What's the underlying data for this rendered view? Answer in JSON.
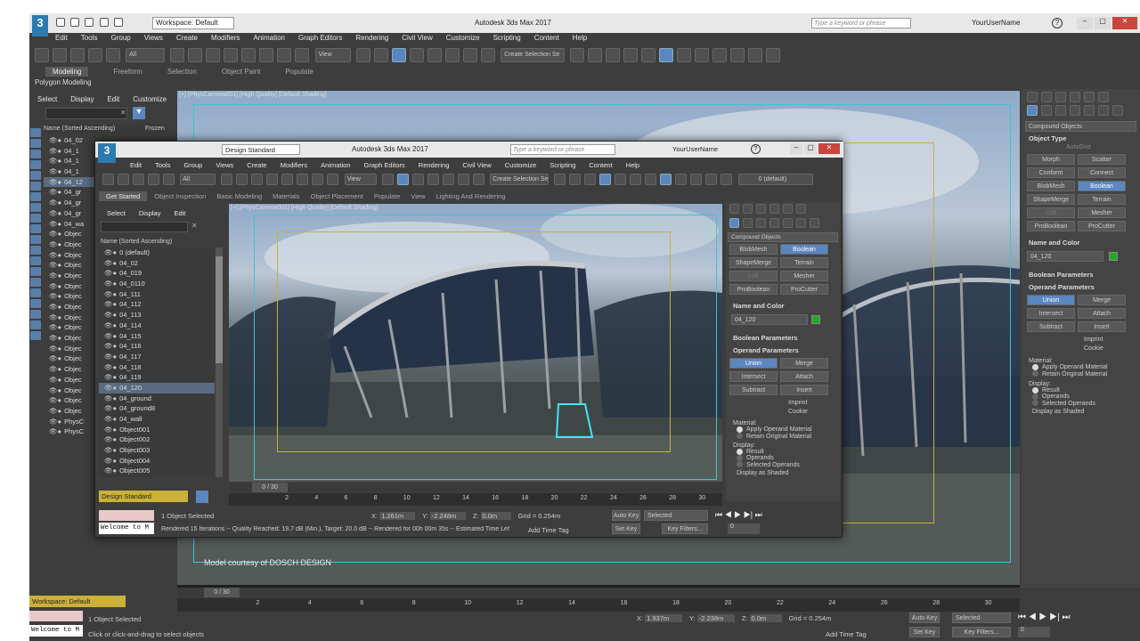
{
  "outer": {
    "title": "Autodesk 3ds Max 2017",
    "workspace": "Workspace: Default",
    "search_placeholder": "Type a keyword or phrase",
    "user": "YourUserName",
    "menu": [
      "Edit",
      "Tools",
      "Group",
      "Views",
      "Create",
      "Modifiers",
      "Animation",
      "Graph Editors",
      "Rendering",
      "Civil View",
      "Customize",
      "Scripting",
      "Content",
      "Help"
    ],
    "filter": "All",
    "view_dropdown": "View",
    "create_selection": "Create Selection Se",
    "ribbon_tabs": [
      "Modeling",
      "Freeform",
      "Selection",
      "Object Paint",
      "Populate"
    ],
    "ribbon_sub": "Polygon Modeling",
    "scene_menu": [
      "Select",
      "Display",
      "Edit",
      "Customize"
    ],
    "col_header": "Name (Sorted Ascending)",
    "frozen": "Frozen",
    "rows": [
      "04_02",
      "04_1",
      "04_1",
      "04_1",
      "04_12",
      "04_gr",
      "04_gr",
      "04_gr",
      "04_wa",
      "Objec",
      "Objec",
      "Objec",
      "Objec",
      "Objec",
      "Objec",
      "Objec",
      "Objec",
      "Objec",
      "Objec",
      "Objec",
      "Objec",
      "Objec",
      "Objec",
      "Objec",
      "Objec",
      "Objec",
      "Objec",
      "PhysC",
      "PhysC"
    ],
    "viewport_label": "[+] [PhysCamera001] [High Quality] [Default Shading]",
    "credit": "Model courtesy of DOSCH DESIGN",
    "frame_counter": "0 / 30",
    "ruler": [
      "2",
      "4",
      "6",
      "8",
      "10",
      "12",
      "14",
      "16",
      "18",
      "20",
      "22",
      "24",
      "26",
      "28",
      "30"
    ],
    "status_selected": "1 Object Selected",
    "status_prompt": "Click or click-and-drag to select objects",
    "maxscript": "Welcome to M",
    "coord_x": "1.937m",
    "coord_y": "-2.238m",
    "coord_z": "0.0m",
    "grid": "Grid = 0.254m",
    "add_time_tag": "Add Time Tag",
    "auto_key": "Auto Key",
    "selected": "Selected",
    "set_key": "Set Key",
    "key_filters": "Key Filters...",
    "frame_field": "0",
    "workspace_bottom": "Workspace: Default",
    "compound": "Compound Objects",
    "object_type": "Object Type",
    "autogrid": "AutoGrid",
    "types": [
      [
        "Morph",
        "Scatter"
      ],
      [
        "Conform",
        "Connect"
      ],
      [
        "BlobMesh",
        "Boolean"
      ],
      [
        "ShapeMerge",
        "Terrain"
      ],
      [
        "Loft",
        "Mesher"
      ],
      [
        "ProBoolean",
        "ProCutter"
      ]
    ],
    "name_color": "Name and Color",
    "obj_name": "04_120",
    "boolean_params": "Boolean Parameters",
    "operand_params": "Operand Parameters",
    "ops": [
      [
        "Union",
        "Merge"
      ],
      [
        "Intersect",
        "Attach"
      ],
      [
        "Subtract",
        "Insert"
      ]
    ],
    "imprint": "Imprint",
    "cookie": "Cookie",
    "material": "Material:",
    "mat_opts": [
      "Apply Operand Material",
      "Retain Original Material"
    ],
    "display": "Display:",
    "disp_opts": [
      "Result",
      "Operands",
      "Selected Operands"
    ],
    "display_shaded": "Display as Shaded"
  },
  "inner": {
    "title": "Autodesk 3ds Max 2017",
    "workspace": "Design Standard",
    "search_placeholder": "Type a keyword or phrase",
    "user": "YourUserName",
    "menu": [
      "Edit",
      "Tools",
      "Group",
      "Views",
      "Create",
      "Modifiers",
      "Animation",
      "Graph Editors",
      "Rendering",
      "Civil View",
      "Customize",
      "Scripting",
      "Content",
      "Help"
    ],
    "filter": "All",
    "view_dropdown": "View",
    "create_selection": "Create Selection Se",
    "layer_default": "0 (default)",
    "ribbon_tabs": [
      "Get Started",
      "Object Inspection",
      "Basic Modeling",
      "Materials",
      "Object Placement",
      "Populate",
      "View",
      "Lighting And Rendering"
    ],
    "scene_menu": [
      "Select",
      "Display",
      "Edit"
    ],
    "col_header": "Name (Sorted Ascending)",
    "rows": [
      "0 (default)",
      "04_02",
      "04_019",
      "04_0110",
      "04_111",
      "04_112",
      "04_113",
      "04_114",
      "04_115",
      "04_116",
      "04_117",
      "04_118",
      "04_119",
      "04_120",
      "04_ground",
      "04_ground8",
      "04_wall",
      "Object001",
      "Object002",
      "Object003",
      "Object004",
      "Object005"
    ],
    "viewport_label": "[+] [PhysCamera001] [High Quality] [Default Shading]",
    "workspace_bottom": "Design Standard",
    "frame_counter": "0 / 30",
    "ruler": [
      "2",
      "4",
      "6",
      "8",
      "10",
      "12",
      "14",
      "16",
      "18",
      "20",
      "22",
      "24",
      "26",
      "28",
      "30"
    ],
    "status_selected": "1 Object Selected",
    "status_render": "Rendered 15 Iterations -- Quality Reached: 19.7 dB (Min.), Target: 20.0 dB -- Rendered for 00h 00m 35s -- Estimated Time Lef",
    "maxscript": "Welcome to M",
    "coord_x": "1.261m",
    "coord_y": "-2.248m",
    "coord_z": "0.0m",
    "grid": "Grid = 0.254m",
    "add_time_tag": "Add Time Tag",
    "auto_key": "Auto Key",
    "selected": "Selected",
    "set_key": "Set Key",
    "key_filters": "Key Filters...",
    "frame_field": "0",
    "compound": "Compound Objects",
    "types": [
      [
        "BlobMesh",
        "Boolean"
      ],
      [
        "ShapeMerge",
        "Terrain"
      ],
      [
        "Loft",
        "Mesher"
      ],
      [
        "ProBoolean",
        "ProCutter"
      ]
    ],
    "name_color": "Name and Color",
    "obj_name": "04_120",
    "boolean_params": "Boolean Parameters",
    "operand_params": "Operand Parameters",
    "ops": [
      [
        "Union",
        "Merge"
      ],
      [
        "Intersect",
        "Attach"
      ],
      [
        "Subtract",
        "Insert"
      ]
    ],
    "imprint": "Imprint",
    "cookie": "Cookie",
    "material": "Material:",
    "mat_opts": [
      "Apply Operand Material",
      "Retain Original Material"
    ],
    "display": "Display:",
    "disp_opts": [
      "Result",
      "Operands",
      "Selected Operands"
    ],
    "display_shaded": "Display as Shaded"
  },
  "colors": {
    "accent": "#5b87c0",
    "object_color": "#22aa22",
    "frame_cyan": "#3cc4d4",
    "frame_yellow": "#c9b13a"
  }
}
